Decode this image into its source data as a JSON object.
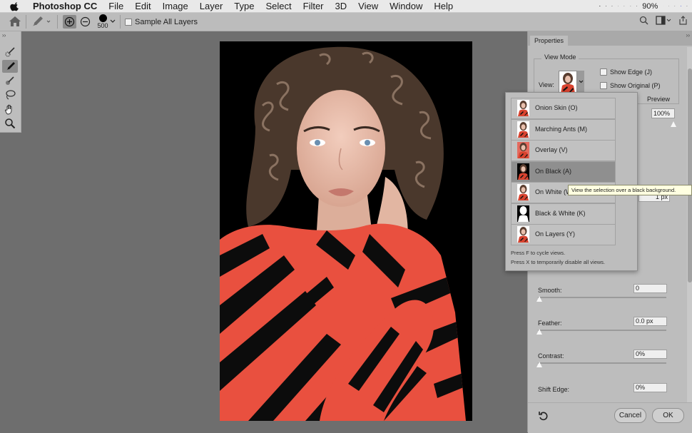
{
  "menubar": {
    "app": "Photoshop CC",
    "items": [
      "File",
      "Edit",
      "Image",
      "Layer",
      "Type",
      "Select",
      "Filter",
      "3D",
      "View",
      "Window",
      "Help"
    ],
    "battery": "90%"
  },
  "options": {
    "brush_size": "500",
    "sample_all_layers": "Sample All Layers"
  },
  "properties": {
    "tab": "Properties",
    "view_mode_legend": "View Mode",
    "view_label": "View:",
    "show_edge": "Show Edge (J)",
    "show_original": "Show Original (P)",
    "preview": "Preview",
    "opacity": "100%",
    "radius_value": "1 px",
    "smooth_label": "Smooth:",
    "smooth_value": "0",
    "feather_label": "Feather:",
    "feather_value": "0.0 px",
    "contrast_label": "Contrast:",
    "contrast_value": "0%",
    "shift_label": "Shift Edge:",
    "shift_value": "0%",
    "cancel": "Cancel",
    "ok": "OK"
  },
  "view_menu": {
    "items": [
      {
        "label": "Onion Skin (O)",
        "thumb": "color"
      },
      {
        "label": "Marching Ants (M)",
        "thumb": "color"
      },
      {
        "label": "Overlay (V)",
        "thumb": "overlay"
      },
      {
        "label": "On Black (A)",
        "thumb": "black",
        "highlighted": true
      },
      {
        "label": "On White (W)",
        "thumb": "white"
      },
      {
        "label": "Black & White (K)",
        "thumb": "bw"
      },
      {
        "label": "On Layers (Y)",
        "thumb": "color"
      }
    ],
    "hint1": "Press F to cycle views.",
    "hint2": "Press X to temporarily disable all views."
  },
  "tooltip": "View the selection over a black background.",
  "colors": {
    "accent": "#5b5b5b",
    "tooltip_bg": "#ffffe1",
    "stripe_red": "#e9503f"
  }
}
